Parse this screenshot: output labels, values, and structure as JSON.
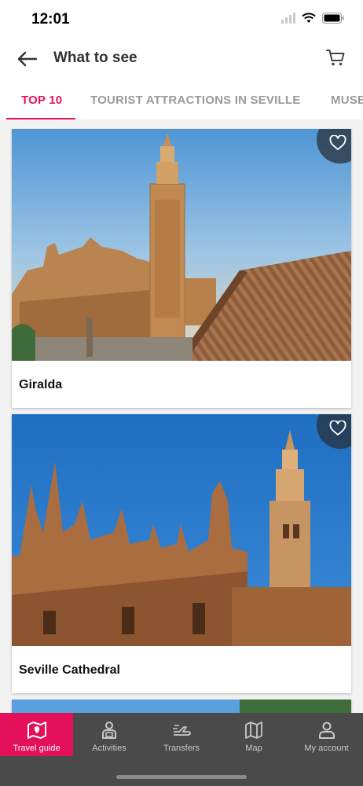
{
  "status": {
    "time": "12:01"
  },
  "header": {
    "title": "What to see",
    "back_icon": "arrow-left-icon",
    "cart_icon": "cart-icon"
  },
  "tabs": [
    {
      "label": "TOP 10",
      "active": true
    },
    {
      "label": "TOURIST ATTRACTIONS IN SEVILLE",
      "active": false
    },
    {
      "label": "MUSE",
      "active": false
    }
  ],
  "cards": [
    {
      "title": "Giralda",
      "favorite_icon": "heart-outline-icon"
    },
    {
      "title": "Seville Cathedral",
      "favorite_icon": "heart-outline-icon"
    }
  ],
  "bottom_nav": [
    {
      "label": "Travel guide",
      "icon": "map-guide-icon",
      "active": true
    },
    {
      "label": "Activities",
      "icon": "activities-icon",
      "active": false
    },
    {
      "label": "Transfers",
      "icon": "transfers-icon",
      "active": false
    },
    {
      "label": "Map",
      "icon": "map-icon",
      "active": false
    },
    {
      "label": "My account",
      "icon": "user-icon",
      "active": false
    }
  ],
  "colors": {
    "accent": "#e4105c",
    "nav_background": "#4a4a4a"
  }
}
